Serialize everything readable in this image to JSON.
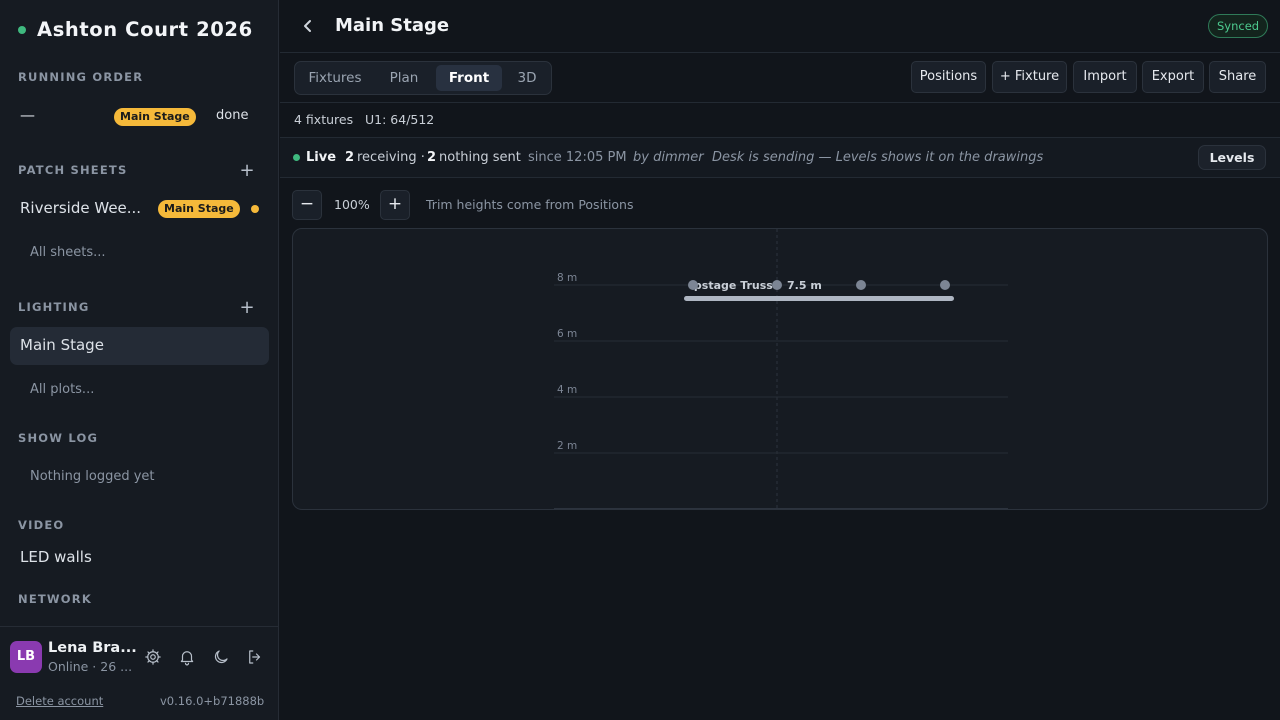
{
  "app": {
    "title": "Ashton Court 2026"
  },
  "sidebar": {
    "running_order": {
      "heading": "RUNNING ORDER",
      "item": {
        "label": "—",
        "badge": "Main Stage",
        "status": "done"
      }
    },
    "patch_sheets": {
      "heading": "PATCH SHEETS",
      "add": "+",
      "item": {
        "label": "Riverside Wee...",
        "badge": "Main Stage"
      },
      "all_link": "All sheets..."
    },
    "lighting": {
      "heading": "LIGHTING",
      "add": "+",
      "item": {
        "label": "Main Stage"
      },
      "all_link": "All plots..."
    },
    "show_log": {
      "heading": "SHOW LOG",
      "empty": "Nothing logged yet"
    },
    "video": {
      "heading": "VIDEO",
      "item": "LED walls"
    },
    "network": {
      "heading": "NETWORK"
    },
    "user": {
      "initials": "LB",
      "name": "Lena Bra...",
      "status": "Online · 26 ...",
      "icons": [
        "gear-icon",
        "bell-icon",
        "moon-icon",
        "logout-icon"
      ]
    },
    "delete_account": "Delete account",
    "version": "v0.16.0+b71888b"
  },
  "header": {
    "title": "Main Stage",
    "sync_status": "Synced"
  },
  "toolbar": {
    "tabs": [
      {
        "label": "Fixtures"
      },
      {
        "label": "Plan"
      },
      {
        "label": "Front",
        "active": true
      },
      {
        "label": "3D"
      }
    ],
    "buttons": {
      "positions": "Positions",
      "add_fixture": "+ Fixture",
      "import": "Import",
      "export": "Export",
      "share": "Share"
    }
  },
  "info": {
    "fixtures": "4 fixtures",
    "universe": "U1: 64/512"
  },
  "live": {
    "label": "Live",
    "receiving_count": "2",
    "receiving_text": "receiving ·",
    "nothing_count": "2",
    "nothing_text": "nothing sent",
    "since": "since 12:05 PM",
    "by": "by dimmer",
    "note": "Desk is sending — Levels shows it on the drawings",
    "levels_button": "Levels"
  },
  "zoom": {
    "minus": "−",
    "value": "100%",
    "plus": "+",
    "hint": "Trim heights come from Positions"
  },
  "front_view": {
    "height_marks": [
      "8 m",
      "6 m",
      "4 m",
      "2 m"
    ],
    "truss": {
      "label": "Upstage Truss",
      "height": "7.5 m",
      "fixture_count": 4
    },
    "colors": {
      "fixture": "#7c8594",
      "truss": "#aeb6c2",
      "grid": "#262c35"
    }
  }
}
